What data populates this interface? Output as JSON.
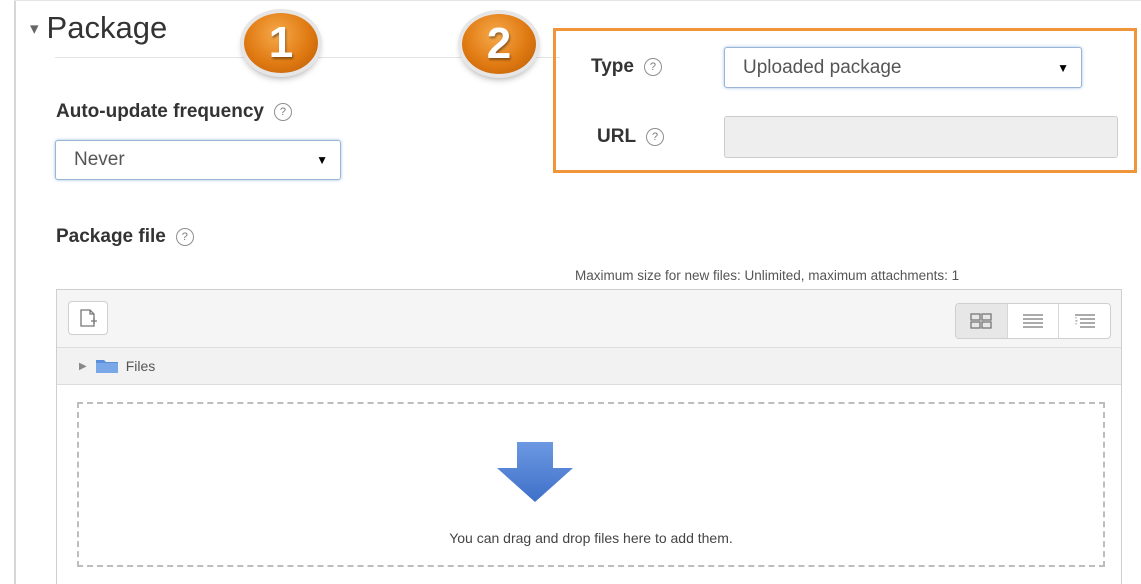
{
  "section": {
    "caret": "▾",
    "title": "Package"
  },
  "badges": [
    "1",
    "2"
  ],
  "auto_update": {
    "label": "Auto-update frequency",
    "value": "Never"
  },
  "type_field": {
    "label": "Type",
    "value": "Uploaded package"
  },
  "url_field": {
    "label": "URL",
    "value": ""
  },
  "package_file": {
    "label": "Package file",
    "max_size_text": "Maximum size for new files: Unlimited, maximum attachments: 1"
  },
  "filepicker": {
    "path_label": "Files",
    "drop_text": "You can drag and drop files here to add them."
  },
  "colors": {
    "callout_border": "#f0953a",
    "badge": "#e07a12",
    "drop_arrow": "#4f80d6",
    "folder": "#5b8fd9"
  },
  "icons": {
    "help": "question-circle-icon",
    "add_file": "file-add-icon",
    "view_icons": "grid-view-icon",
    "view_details": "list-view-icon",
    "view_tree": "tree-view-icon",
    "folder": "folder-icon",
    "drop": "down-arrow-icon"
  }
}
